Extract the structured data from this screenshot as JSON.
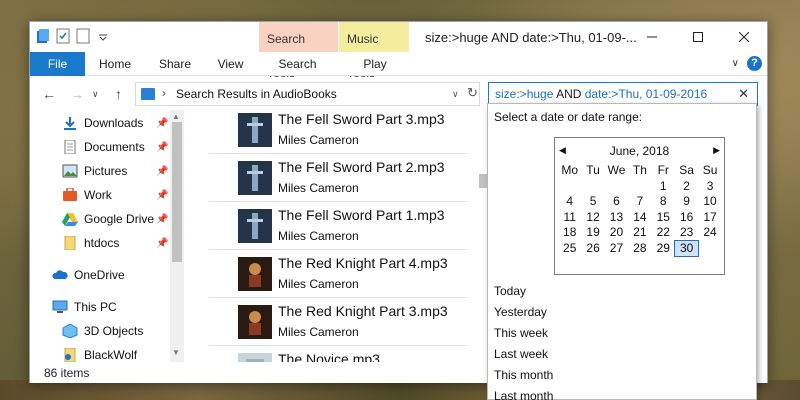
{
  "window": {
    "title": "size:>huge AND date:>Thu, 01-09-...",
    "context_tabs": [
      "Search Tools",
      "Music Tools"
    ]
  },
  "ribbon": {
    "tabs": [
      "File",
      "Home",
      "Share",
      "View",
      "Search",
      "Play"
    ]
  },
  "address": {
    "path": "Search Results in AudioBooks",
    "separator": "›"
  },
  "search": {
    "kw1": "size:>",
    "val1": "huge",
    "op": " AND ",
    "kw2": "date:>",
    "val2": "Thu, 01-09-2016"
  },
  "nav": {
    "items": [
      "Downloads",
      "Documents",
      "Pictures",
      "Work",
      "Google Drive",
      "htdocs",
      "OneDrive",
      "This PC",
      "3D Objects",
      "BlackWolf"
    ]
  },
  "files": [
    {
      "name": "The Fell Sword Part 3.mp3",
      "artist": "Miles Cameron"
    },
    {
      "name": "The Fell Sword Part 2.mp3",
      "artist": "Miles Cameron"
    },
    {
      "name": "The Fell Sword Part 1.mp3",
      "artist": "Miles Cameron"
    },
    {
      "name": "The Red Knight Part 4.mp3",
      "artist": "Miles Cameron"
    },
    {
      "name": "The Red Knight Part 3.mp3",
      "artist": "Miles Cameron"
    },
    {
      "name": "The Novice.mp3",
      "artist": ""
    }
  ],
  "status": {
    "count": "86 items"
  },
  "datepicker": {
    "header": "Select a date or date range:",
    "month": "June, 2018",
    "weekdays": [
      "Mo",
      "Tu",
      "We",
      "Th",
      "Fr",
      "Sa",
      "Su"
    ],
    "weeks": [
      [
        "",
        "",
        "",
        "",
        "1",
        "2",
        "3"
      ],
      [
        "4",
        "5",
        "6",
        "7",
        "8",
        "9",
        "10"
      ],
      [
        "11",
        "12",
        "13",
        "14",
        "15",
        "16",
        "17"
      ],
      [
        "18",
        "19",
        "20",
        "21",
        "22",
        "23",
        "24"
      ],
      [
        "25",
        "26",
        "27",
        "28",
        "29",
        "30",
        ""
      ]
    ],
    "selected": "30",
    "quick": [
      "Today",
      "Yesterday",
      "This week",
      "Last week",
      "This month",
      "Last month"
    ]
  },
  "colors": {
    "accent": "#1979ca",
    "search_tools_tab": "#f9d2c1",
    "music_tools_tab": "#f4ec9e",
    "keyword": "#1a6fc4"
  },
  "icons": {
    "close": "close-icon",
    "minimize": "minimize-icon",
    "maximize": "maximize-icon",
    "help": "help-icon",
    "refresh": "refresh-icon"
  }
}
